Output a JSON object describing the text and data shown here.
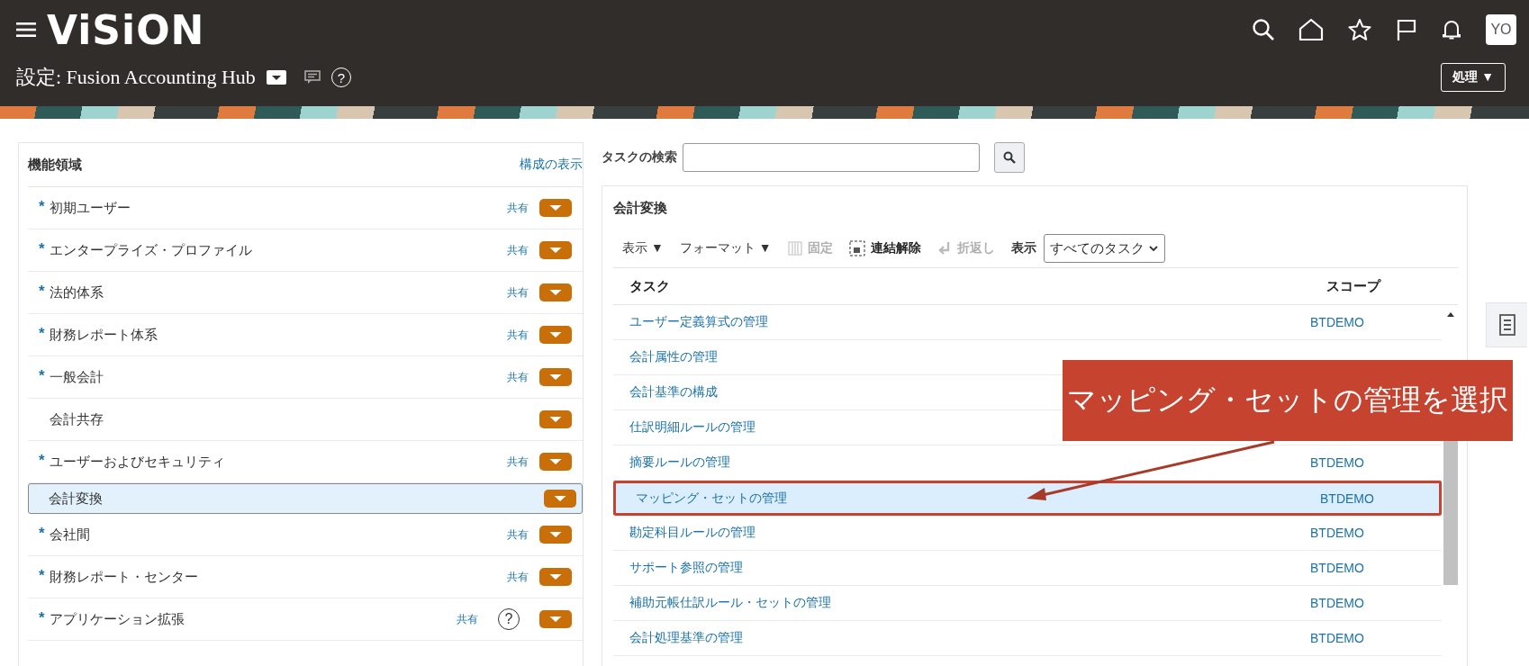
{
  "header": {
    "logo": "ViSiON",
    "avatar": "YO",
    "title": "設定: Fusion Accounting Hub",
    "help": "?",
    "actions_button": "処理 ▼"
  },
  "functional_areas": {
    "title": "機能領域",
    "link": "構成の表示",
    "items": [
      {
        "label": "初期ユーザー",
        "required_mark": "*",
        "shared": "共有",
        "selected": false
      },
      {
        "label": "エンタープライズ・プロファイル",
        "required_mark": "*",
        "shared": "共有",
        "selected": false
      },
      {
        "label": "法的体系",
        "required_mark": "*",
        "shared": "共有",
        "selected": false
      },
      {
        "label": "財務レポート体系",
        "required_mark": "*",
        "shared": "共有",
        "selected": false
      },
      {
        "label": "一般会計",
        "required_mark": "*",
        "shared": "共有",
        "selected": false
      },
      {
        "label": "会計共存",
        "selected": false
      },
      {
        "label": "ユーザーおよびセキュリティ",
        "required_mark": "*",
        "shared": "共有",
        "selected": false
      },
      {
        "label": "会計変換",
        "selected": true
      },
      {
        "label": "会社間",
        "required_mark": "*",
        "shared": "共有",
        "selected": false
      },
      {
        "label": "財務レポート・センター",
        "required_mark": "*",
        "shared": "共有",
        "selected": false
      },
      {
        "label": "アプリケーション拡張",
        "required_mark": "*",
        "shared": "共有",
        "help": "?",
        "selected": false
      }
    ]
  },
  "task_search": {
    "label": "タスクの検索"
  },
  "tasks_panel": {
    "title": "会計変換",
    "toolbar": [
      {
        "kind": "menu",
        "label": "表示",
        "caret": "▼"
      },
      {
        "kind": "menu",
        "label": "フォーマット",
        "caret": "▼"
      },
      {
        "kind": "freeze",
        "label": "固定",
        "disabled": true
      },
      {
        "kind": "detach",
        "label": "連結解除",
        "disabled": false
      },
      {
        "kind": "wrap",
        "label": "折返し",
        "disabled": true
      },
      {
        "kind": "label",
        "label": "表示"
      },
      {
        "kind": "select",
        "value": "すべてのタスク"
      }
    ],
    "columns": [
      "タスク",
      "スコープ"
    ],
    "rows": [
      {
        "task": "ユーザー定義算式の管理",
        "scope": "BTDEMO",
        "selected": false
      },
      {
        "task": "会計属性の管理",
        "selected": false
      },
      {
        "task": "会計基準の構成",
        "selected": false
      },
      {
        "task": "仕訳明細ルールの管理",
        "selected": false
      },
      {
        "task": "摘要ルールの管理",
        "scope": "BTDEMO",
        "selected": false
      },
      {
        "task": "マッピング・セットの管理",
        "scope": "BTDEMO",
        "selected": true
      },
      {
        "task": "勘定科目ルールの管理",
        "scope": "BTDEMO",
        "selected": false
      },
      {
        "task": "サポート参照の管理",
        "scope": "BTDEMO",
        "selected": false
      },
      {
        "task": "補助元帳仕訳ルール・セットの管理",
        "scope": "BTDEMO",
        "selected": false
      },
      {
        "task": "会計処理基準の管理",
        "scope": "BTDEMO",
        "selected": false
      }
    ]
  },
  "callout": {
    "text": "マッピング・セットの管理を選択"
  }
}
